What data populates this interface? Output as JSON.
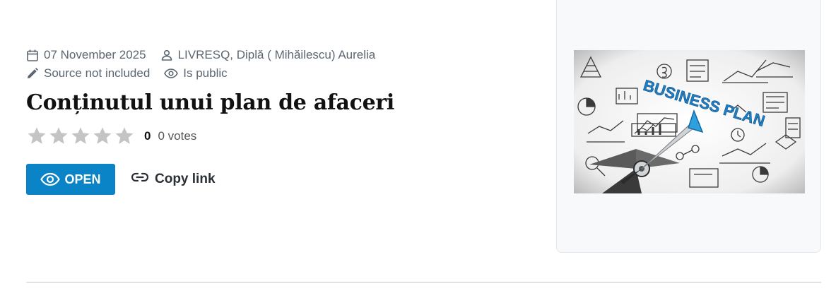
{
  "meta": {
    "date": "07 November 2025",
    "author": "LIVRESQ, Diplă ( Mihăilescu) Aurelia",
    "source": "Source not included",
    "visibility": "Is public"
  },
  "title": "Conținutul unui plan de afaceri",
  "rating": {
    "stars_total": 5,
    "stars_filled": 0,
    "count": "0",
    "votes": "0 votes"
  },
  "actions": {
    "open_label": "OPEN",
    "copy_label": "Copy link"
  },
  "thumbnail": {
    "text": "BUSINESS PLAN"
  },
  "colors": {
    "primary": "#0a84c6",
    "meta_text": "#5c6670",
    "star_empty": "#c4c4c4"
  }
}
